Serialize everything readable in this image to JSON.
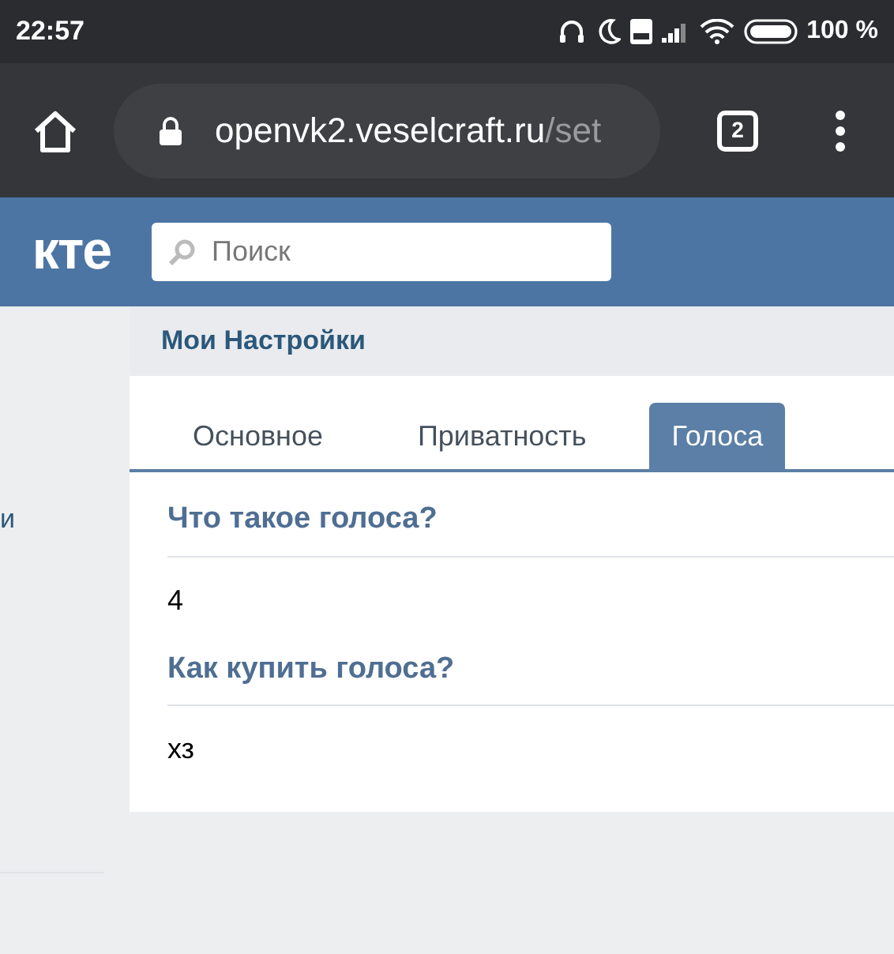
{
  "status_bar": {
    "time": "22:57",
    "battery": "100 %"
  },
  "browser": {
    "url_host": "openvk2.veselcraft.ru",
    "url_path": "/set",
    "tab_count": "2"
  },
  "header": {
    "logo": "кте",
    "search": {
      "placeholder": "Поиск"
    }
  },
  "sidebar": {
    "items": [
      "и"
    ]
  },
  "page": {
    "title": "Мои Настройки",
    "tabs": [
      {
        "label": "Основное",
        "selected": false
      },
      {
        "label": "Приватность",
        "selected": false
      },
      {
        "label": "Голоса",
        "selected": true
      }
    ],
    "sections": [
      {
        "heading": "Что такое голоса?",
        "text": "4"
      },
      {
        "heading": "Как купить голоса?",
        "text": "хз"
      }
    ]
  }
}
